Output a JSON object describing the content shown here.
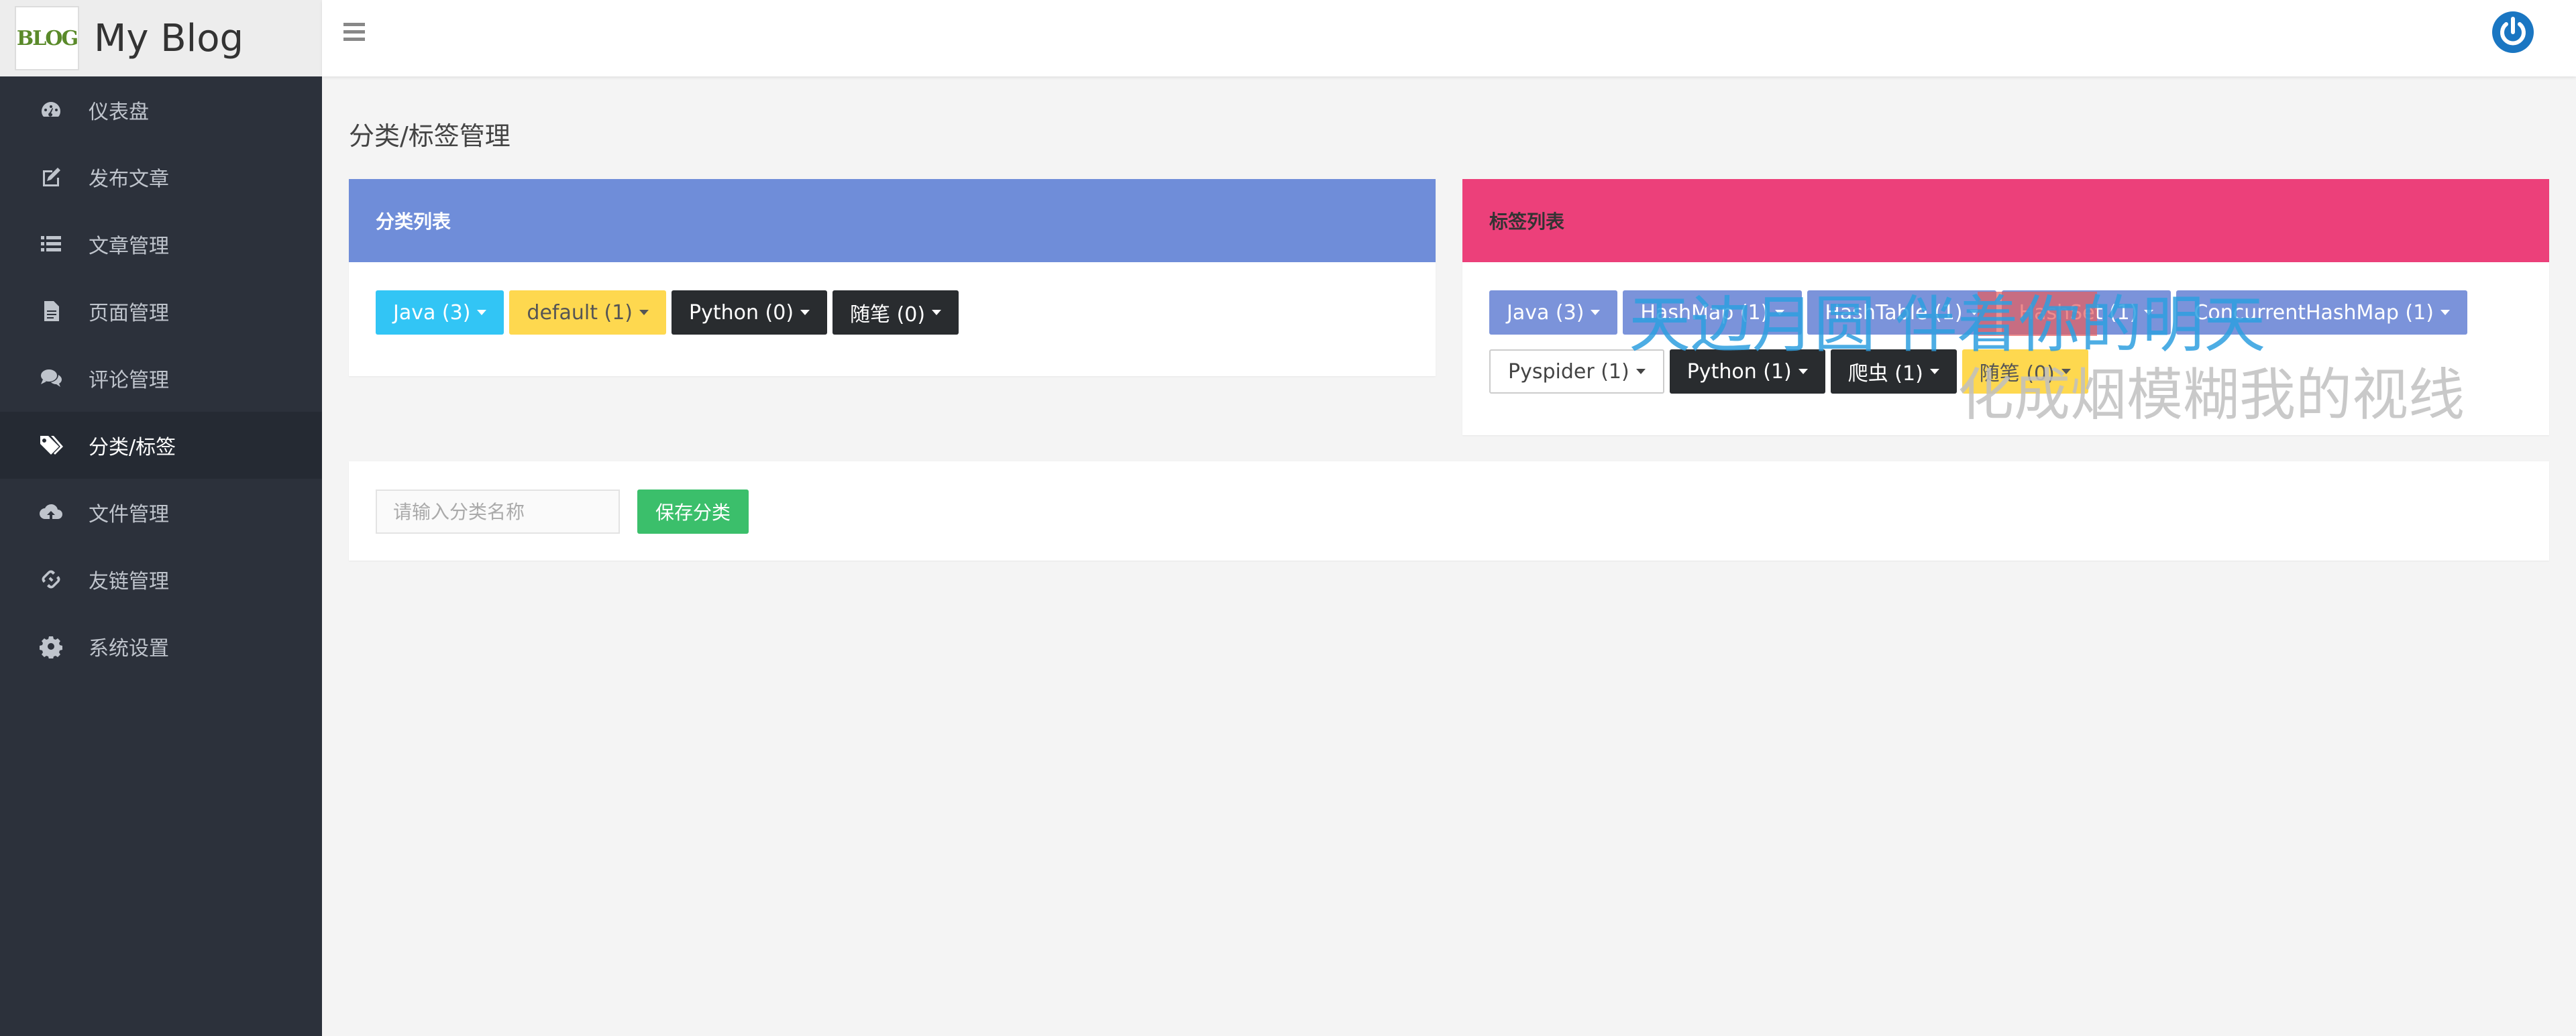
{
  "brand": {
    "logo_text": "BLOG",
    "name": "My Blog"
  },
  "sidebar": {
    "items": [
      {
        "label": "仪表盘",
        "icon": "dashboard-icon"
      },
      {
        "label": "发布文章",
        "icon": "edit-icon"
      },
      {
        "label": "文章管理",
        "icon": "list-icon"
      },
      {
        "label": "页面管理",
        "icon": "file-icon"
      },
      {
        "label": "评论管理",
        "icon": "comments-icon"
      },
      {
        "label": "分类/标签",
        "icon": "tags-icon",
        "active": true
      },
      {
        "label": "文件管理",
        "icon": "cloud-upload-icon"
      },
      {
        "label": "友链管理",
        "icon": "link-icon"
      },
      {
        "label": "系统设置",
        "icon": "gear-icon"
      }
    ]
  },
  "topbar": {
    "menu_icon": "hamburger-icon",
    "power_icon": "power-icon"
  },
  "page": {
    "title": "分类/标签管理"
  },
  "categories": {
    "title": "分类列表",
    "header_color": "#6f8dd9",
    "items": [
      {
        "label": "Java (3)",
        "color": "blue"
      },
      {
        "label": "default (1)",
        "color": "yellow"
      },
      {
        "label": "Python (0)",
        "color": "dark"
      },
      {
        "label": "随笔 (0)",
        "color": "dark"
      }
    ]
  },
  "tags": {
    "title": "标签列表",
    "header_color": "#ec407a",
    "row1": [
      {
        "label": "Java (3)",
        "color": "slate"
      },
      {
        "label": "HashMap (1)",
        "color": "slate"
      },
      {
        "label": "HashTable (1)",
        "color": "slate"
      },
      {
        "label": "HashSet (1)",
        "color": "slate"
      },
      {
        "label": "ConcurrentHashMap (1)",
        "color": "slate"
      }
    ],
    "row2": [
      {
        "label": "Pyspider (1)",
        "color": "white"
      },
      {
        "label": "Python (1)",
        "color": "dark"
      },
      {
        "label": "爬虫 (1)",
        "color": "dark"
      },
      {
        "label": "随笔 (0)",
        "color": "yellow"
      }
    ]
  },
  "overlay": {
    "line1": "天边月圆 伴着你的明天",
    "line2": "化成烟模糊我的视线"
  },
  "save_form": {
    "placeholder": "请输入分类名称",
    "button_label": "保存分类"
  }
}
